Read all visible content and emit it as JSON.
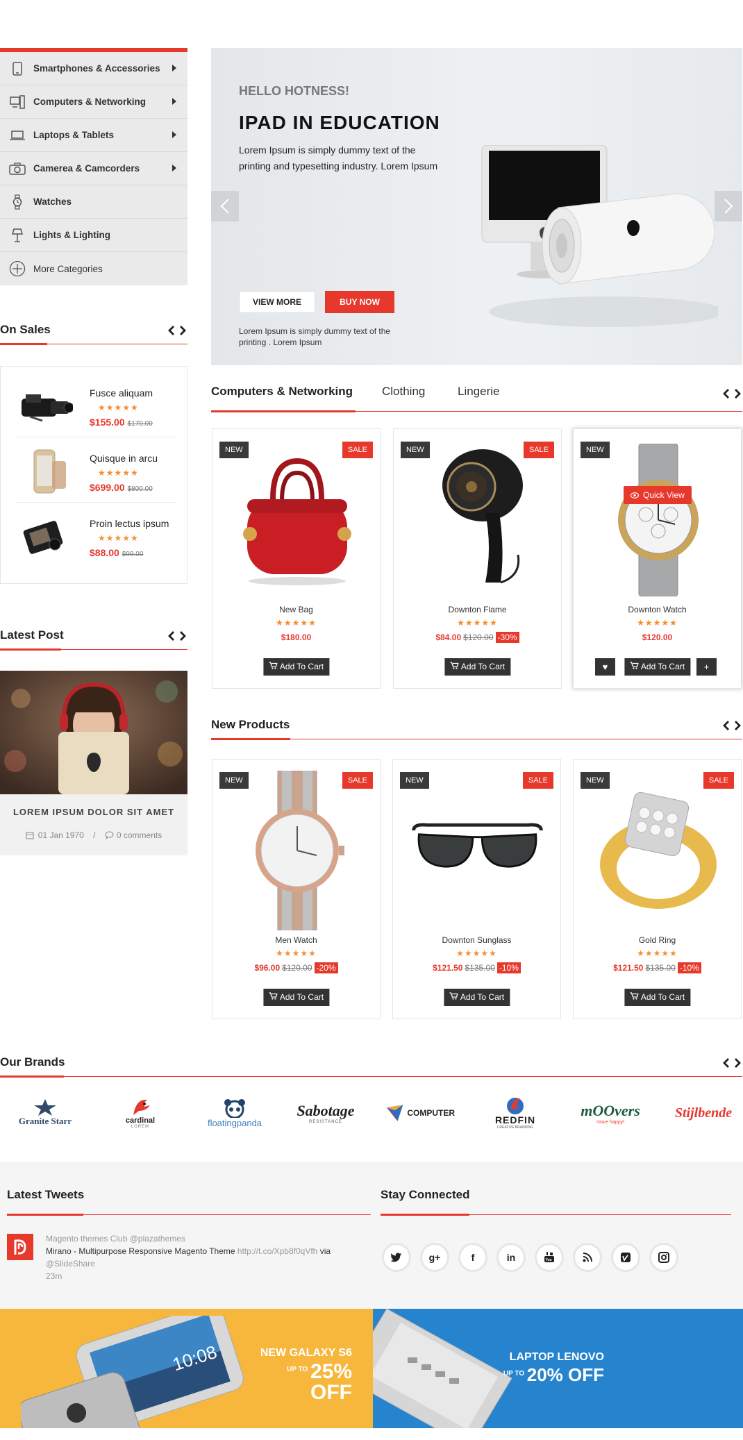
{
  "categories": [
    {
      "label": "Smartphones & Accessories",
      "icon": "smartphone-icon",
      "has_sub": true
    },
    {
      "label": "Computers & Networking",
      "icon": "computer-icon",
      "has_sub": true
    },
    {
      "label": "Laptops & Tablets",
      "icon": "laptop-icon",
      "has_sub": true
    },
    {
      "label": "Camerea & Camcorders",
      "icon": "camera-icon",
      "has_sub": true
    },
    {
      "label": "Watches",
      "icon": "watch-icon",
      "has_sub": false
    },
    {
      "label": "Lights & Lighting",
      "icon": "lamp-icon",
      "has_sub": false
    },
    {
      "label": "More Categories",
      "icon": "plus-circle-icon",
      "has_sub": false
    }
  ],
  "on_sales": {
    "title": "On Sales",
    "items": [
      {
        "name": "Fusce aliquam",
        "stars": "★★★★★",
        "price": "$155.00",
        "old_price": "$170.00"
      },
      {
        "name": "Quisque in arcu",
        "stars": "★★★★★",
        "price": "$699.00",
        "old_price": "$800.00"
      },
      {
        "name": "Proin lectus ipsum",
        "stars": "★★★★★",
        "price": "$88.00",
        "old_price": "$99.00"
      }
    ]
  },
  "latest_post": {
    "title": "Latest Post",
    "post_title": "LOREM IPSUM DOLOR SIT AMET",
    "date": "01 Jan 1970",
    "separator": "/",
    "comments": "0 comments"
  },
  "slider": {
    "subtitle": "HELLO HOTNESS!",
    "title": "IPAD IN EDUCATION",
    "text": "Lorem Ipsum is simply dummy text of the printing and typesetting industry. Lorem Ipsum",
    "view_more": "VIEW MORE",
    "buy_now": "BUY NOW",
    "footer_text": "Lorem Ipsum is simply dummy text of the printing . Lorem Ipsum"
  },
  "tabs": [
    "Computers & Networking",
    "Clothing",
    "Lingerie"
  ],
  "tab_products": [
    {
      "name": "New Bag",
      "stars": "★★★★★",
      "price": "$180.00",
      "old_price": "",
      "discount": "",
      "badge_new": "NEW",
      "badge_sale": "SALE"
    },
    {
      "name": "Downton Flame",
      "stars": "★★★★★",
      "price": "$84.00",
      "old_price": "$120.00",
      "discount": "-30%",
      "badge_new": "NEW",
      "badge_sale": "SALE"
    },
    {
      "name": "Downton Watch",
      "stars": "★★★★★",
      "price": "$120.00",
      "old_price": "",
      "discount": "",
      "badge_new": "NEW",
      "badge_sale": "",
      "quick_view": "Quick View"
    }
  ],
  "new_products": {
    "title": "New Products",
    "items": [
      {
        "name": "Men Watch",
        "stars": "★★★★★",
        "price": "$96.00",
        "old_price": "$120.00",
        "discount": "-20%",
        "badge_new": "NEW",
        "badge_sale": "SALE"
      },
      {
        "name": "Downton Sunglass",
        "stars": "★★★★★",
        "price": "$121.50",
        "old_price": "$135.00",
        "discount": "-10%",
        "badge_new": "NEW",
        "badge_sale": "SALE"
      },
      {
        "name": "Gold Ring",
        "stars": "★★★★★",
        "price": "$121.50",
        "old_price": "$135.00",
        "discount": "-10%",
        "badge_new": "NEW",
        "badge_sale": "SALE"
      }
    ]
  },
  "add_to_cart": "Add To Cart",
  "brands": {
    "title": "Our Brands",
    "items": [
      "Granite Starr",
      "cardinal",
      "floatingpanda",
      "Sabotage",
      "COMPUTER",
      "REDFIN",
      "mOOvers",
      "Stijlbende"
    ],
    "sublabels": {
      "sabotage": "RESISTANCE",
      "redfin": "CREATIVE BRANDING",
      "moovers": "move happy!",
      "cardinal": "LOREM"
    }
  },
  "tweets": {
    "title": "Latest Tweets",
    "account": "Magento themes Club @plazathemes",
    "text": "Mirano - Multipurpose Responsive Magento Theme",
    "link": "http://t.co/Xpb8f0qVfh",
    "via": "via",
    "via_account": "@SlideShare",
    "time": "23m"
  },
  "stay_connected": {
    "title": "Stay Connected",
    "icons": [
      "twitter-icon",
      "google-plus-icon",
      "facebook-icon",
      "linkedin-icon",
      "youtube-icon",
      "rss-icon",
      "vimeo-icon",
      "instagram-icon"
    ]
  },
  "banners": {
    "left": {
      "line1": "NEW GALAXY S6",
      "upto": "UP TO",
      "pct": "25%",
      "off": "OFF",
      "phone_time": "10:08"
    },
    "right": {
      "line1": "LAPTOP LENOVO",
      "upto": "UP TO",
      "pct": "20% OFF"
    }
  },
  "colors": {
    "accent": "#e7382c",
    "dark": "#333333",
    "star": "#f68d2e",
    "banner_yellow": "#f6b73c",
    "banner_blue": "#2684cf"
  }
}
